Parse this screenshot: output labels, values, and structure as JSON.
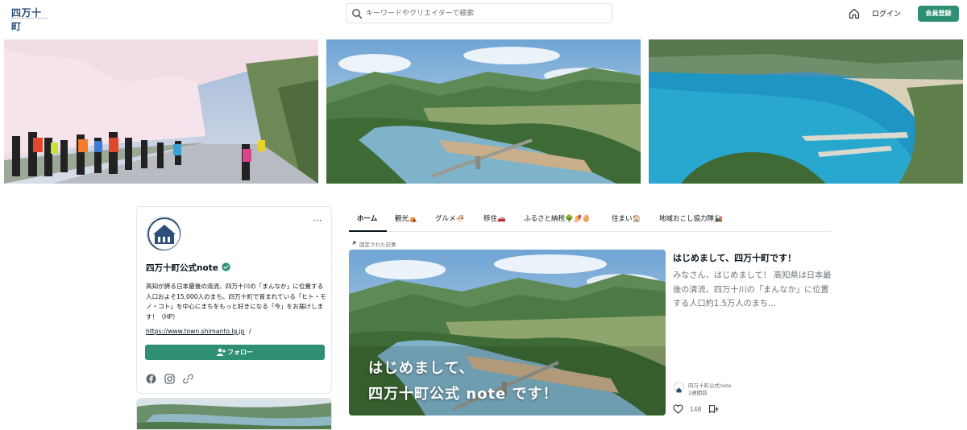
{
  "header": {
    "logo_text": "四万十町",
    "search_placeholder": "キーワードやクリエイターで検索",
    "login_label": "ログイン",
    "signup_label": "会員登録"
  },
  "banner": {
    "images": [
      {
        "subject": "桜並木を走るマラソンランナー"
      },
      {
        "subject": "四万十川と沈下橋の風景"
      },
      {
        "subject": "青い海と湾の風景"
      }
    ]
  },
  "profile": {
    "name": "四万十町公式note",
    "bio": "高知が誇る日本最後の清流、四万十川の「まんなか」に位置する人口およそ15,000人のまち。四万十町で育まれている「ヒト・モノ・コト」を中心にまちをもっと好きになる「今」をお届けします！（HP）",
    "url": "https://www.town.shimanto.lg.jp",
    "url_suffix": "/",
    "follow_label": "フォロー",
    "more_label": "···"
  },
  "tabs": [
    {
      "label": "ホーム",
      "active": true
    },
    {
      "label": "観光⛺"
    },
    {
      "label": "グルメ🍜"
    },
    {
      "label": "移住🚗"
    },
    {
      "label": "ふるさと納税🌳🍠🥚"
    },
    {
      "label": "住まい🏠"
    },
    {
      "label": "地域おこし協力隊🚂"
    }
  ],
  "pinned": {
    "label": "固定された記事",
    "overlay_line1": "はじめまして、",
    "overlay_line2": "四万十町公式 note です！",
    "title": "はじめまして、四万十町です！",
    "excerpt": "みなさん、はじめまして！ 高知県は日本最後の清流、四万十川の「まんなか」に位置する人口約1.5万人のまち…",
    "author": "四万十町公式note",
    "time": "2週間前",
    "likes": "148"
  },
  "colors": {
    "accent": "#2e8f74",
    "text": "#08131a",
    "muted": "#6b7378"
  }
}
